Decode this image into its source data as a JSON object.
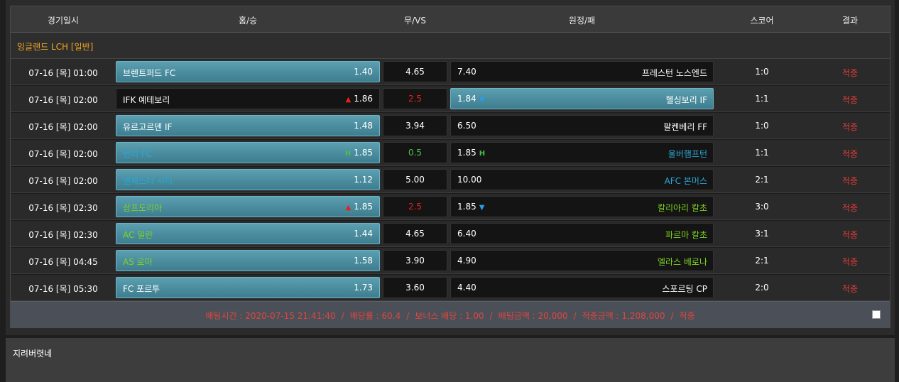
{
  "headers": {
    "date": "경기일시",
    "home": "홈/승",
    "draw": "무/VS",
    "away": "원정/패",
    "score": "스코어",
    "result": "결과"
  },
  "league": "잉글랜드 LCH [일반]",
  "rows": [
    {
      "date": "07-16 [목] 01:00",
      "home": "브렌트퍼드 FC",
      "home_odd": "1.40",
      "draw_odd": "4.65",
      "away_odd": "7.40",
      "away": "프레스턴 노스엔드",
      "score": "1:0",
      "result": "적중",
      "selected": "home",
      "home_color": "#ffffff",
      "away_color": "#ffffff"
    },
    {
      "date": "07-16 [목] 02:00",
      "home": "IFK 예테보리",
      "home_odd": "1.86",
      "draw_odd": "2.5",
      "away_odd": "1.84",
      "away": "헬싱보리 IF",
      "score": "1:1",
      "result": "적중",
      "selected": "away",
      "home_mark": "up",
      "away_mark": "down",
      "draw_color": "#e5211d",
      "home_color": "#ffffff",
      "away_color": "#ffffff"
    },
    {
      "date": "07-16 [목] 02:00",
      "home": "유르고르덴 IF",
      "home_odd": "1.48",
      "draw_odd": "3.94",
      "away_odd": "6.50",
      "away": "팔켄베리 FF",
      "score": "1:0",
      "result": "적중",
      "selected": "home",
      "home_color": "#ffffff",
      "away_color": "#ffffff"
    },
    {
      "date": "07-16 [목] 02:00",
      "home": "번리 FC",
      "home_odd": "1.85",
      "draw_odd": "0.5",
      "away_odd": "1.85",
      "away": "울버햄프턴",
      "score": "1:1",
      "result": "적중",
      "selected": "home",
      "home_mark": "H",
      "away_mark": "H",
      "draw_color": "#49c24a",
      "home_color": "#2ba6d6",
      "away_color": "#2ba6d6"
    },
    {
      "date": "07-16 [목] 02:00",
      "home": "맨체스터 시티",
      "home_odd": "1.12",
      "draw_odd": "5.00",
      "away_odd": "10.00",
      "away": "AFC 본머스",
      "score": "2:1",
      "result": "적중",
      "selected": "home",
      "home_color": "#2ba6d6",
      "away_color": "#2ba6d6"
    },
    {
      "date": "07-16 [목] 02:30",
      "home": "삼프도리아",
      "home_odd": "1.85",
      "draw_odd": "2.5",
      "away_odd": "1.85",
      "away": "칼리아리 칼초",
      "score": "3:0",
      "result": "적중",
      "selected": "home",
      "home_mark": "up",
      "away_mark": "down",
      "draw_color": "#e5211d",
      "home_color": "#7ed321",
      "away_color": "#7ed321"
    },
    {
      "date": "07-16 [목] 02:30",
      "home": "AC 밀란",
      "home_odd": "1.44",
      "draw_odd": "4.65",
      "away_odd": "6.40",
      "away": "파르마 칼초",
      "score": "3:1",
      "result": "적중",
      "selected": "home",
      "home_color": "#7ed321",
      "away_color": "#7ed321"
    },
    {
      "date": "07-16 [목] 04:45",
      "home": "AS 로마",
      "home_odd": "1.58",
      "draw_odd": "3.90",
      "away_odd": "4.90",
      "away": "엘라스 베로나",
      "score": "2:1",
      "result": "적중",
      "selected": "home",
      "home_color": "#7ed321",
      "away_color": "#7ed321"
    },
    {
      "date": "07-16 [목] 05:30",
      "home": "FC 포르투",
      "home_odd": "1.73",
      "draw_odd": "3.60",
      "away_odd": "4.40",
      "away": "스포르팅 CP",
      "score": "2:0",
      "result": "적중",
      "selected": "home",
      "home_color": "#ffffff",
      "away_color": "#ffffff"
    }
  ],
  "footer": {
    "bet_time": "배팅시간 : 2020-07-15 21:41:40",
    "odds": "배당률 : 60.4",
    "bonus": "보너스 배당 : 1.00",
    "amount": "배팅금액 : 20,000",
    "win_amount": "적중금액 : 1,208,000",
    "status": "적중"
  },
  "comment": "지려버렷네",
  "colors": {
    "result": "#e23d3a",
    "league": "#f5a623",
    "selected": "#4f93a5"
  }
}
